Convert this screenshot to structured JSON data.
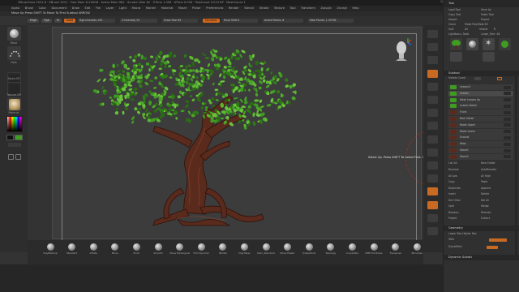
{
  "title_bar": {
    "text": "ZBrushCore 2021.6  ·  ZBrush 2021  ·  Free Mem 6.236GB  ·  Active Mem 962  ·  Scratch Disk 62  ·  ZTime 1.056  ·  ATime 0.094  ·  PolyCount 0.013 KP  ·  MeshCount 1",
    "right_items": [
      "QuickSave",
      "Menus",
      "DefaultZScript"
    ]
  },
  "menu_bar": {
    "items": [
      "Alpha",
      "Brush",
      "Color",
      "Document",
      "Draw",
      "Edit",
      "File",
      "Layer",
      "Light",
      "Macro",
      "Marker",
      "Material",
      "Movie",
      "Picker",
      "Preferences",
      "Render",
      "Stencil",
      "Stroke",
      "Texture",
      "Tool",
      "Transform",
      "Zplugin",
      "Zscript",
      "Help"
    ],
    "right_items": [
      "See-through 0",
      "Menus"
    ]
  },
  "info_bar": {
    "text": "Move Up  Press SHIFT To Move To First Subtool  ARROW"
  },
  "toolbar": {
    "tags": [
      "Mrgb",
      "Rgb",
      "M"
    ],
    "active_tag": "Zadd",
    "sliders": [
      {
        "label": "Rgb Intensity 100"
      },
      {
        "label": "Z Intensity 25"
      },
      {
        "label": "Draw Size 64"
      },
      {
        "label": "Dynamic"
      },
      {
        "label": "Focal Shift 0"
      },
      {
        "label": "Active Points: 8"
      },
      {
        "label": "Total Points: 1.29 Mil"
      }
    ]
  },
  "left_shelf": {
    "items": [
      {
        "label": "Move",
        "icon": "move-brush-icon"
      },
      {
        "label": "Dots",
        "icon": "dots-stroke-icon"
      },
      {
        "label": "Alpha Off",
        "icon": "alpha-icon"
      },
      {
        "label": "Texture Off",
        "icon": "texture-icon"
      },
      {
        "label": "Material",
        "icon": "matcap-icon"
      }
    ]
  },
  "tooltip": {
    "text": "Select Up.  Press SHIFT To Select First.  UP ARROW"
  },
  "bottom_shelf": {
    "brushes": [
      "ClayBuildup",
      "Standard",
      "Inflate",
      "Move",
      "Pinch",
      "Smooth",
      "Move Topological",
      "Trim Dynamic",
      "hPolish",
      "ClayTubes",
      "Dam_Standard",
      "Move Elastic",
      "SnakeHook",
      "Topology",
      "CurveTube",
      "IMM Primitives",
      "Transpose",
      "Zbrushes"
    ]
  },
  "right_strip": {
    "buttons": [
      "BPR",
      "SPix",
      "Scroll",
      "Zoom",
      "Actual",
      "AAHalf",
      "Persp",
      "Floor",
      "Local",
      "Frame",
      "Move",
      "Scale",
      "Rotate",
      "PolyF",
      "Transp",
      "Solo"
    ]
  },
  "tool_palette": {
    "header": "Tool",
    "top_buttons": [
      "Load Tool",
      "Save As",
      "Copy Tool",
      "Paste Tool",
      "Import",
      "Export",
      "Clone",
      "Make PolyMesh3D",
      "GoZ",
      "All",
      "Visible",
      "R"
    ],
    "lightbox_label": "Lightbox ▸ Tools",
    "current_tool": "Large_Tree: 48",
    "subtool_header": "Subtool",
    "subtools": [
      {
        "name": "Leaves3",
        "active": false
      },
      {
        "name": "Leaves",
        "active": true
      },
      {
        "name": "Mesh Leaves Up",
        "active": false
      },
      {
        "name": "Leaves Detail",
        "active": false
      },
      {
        "name": "Trunk",
        "active": false
      },
      {
        "name": "Bark Detail",
        "active": false
      },
      {
        "name": "Roots Upper",
        "active": false
      },
      {
        "name": "Roots Lower",
        "active": false
      },
      {
        "name": "Ground",
        "active": false
      },
      {
        "name": "Moss",
        "active": false
      },
      {
        "name": "Stone1",
        "active": false
      },
      {
        "name": "Stone2",
        "active": false
      }
    ],
    "list_all": "List All",
    "new_folder": "New Folder",
    "actions": [
      "Rename",
      "AutoReorder",
      "All Low",
      "All High",
      "Copy",
      "Paste",
      "Duplicate",
      "Append",
      "Insert",
      "Delete",
      "Del Other",
      "Del All",
      "Split",
      "Merge",
      "Boolean",
      "Remesh",
      "Project",
      "Extract"
    ],
    "geometry_header": "Geometry",
    "geometry_row": "Lower Res   Higher Res",
    "geometry_detail": "SDiv",
    "dynamesh_label": "DynaMesh",
    "dynamic_subdiv": "Dynamic Subdiv"
  },
  "colors": {
    "accent": "#c96a23",
    "leaf_green": "#3f9b22",
    "bark": "#5a2a1c",
    "background": "#3c3c3c"
  }
}
